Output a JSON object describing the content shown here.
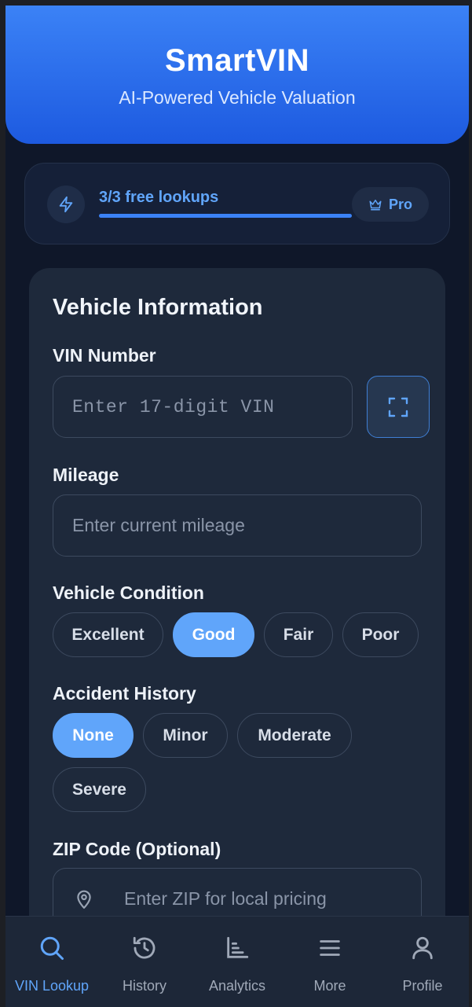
{
  "app": {
    "title": "SmartVIN",
    "subtitle": "AI-Powered Vehicle Valuation"
  },
  "quota": {
    "text": "3/3 free lookups",
    "used_fraction": 1.0,
    "pro_label": "Pro"
  },
  "form": {
    "title": "Vehicle Information",
    "vin": {
      "label": "VIN Number",
      "placeholder": "Enter 17-digit VIN",
      "value": ""
    },
    "mileage": {
      "label": "Mileage",
      "placeholder": "Enter current mileage",
      "value": ""
    },
    "condition": {
      "label": "Vehicle Condition",
      "options": [
        "Excellent",
        "Good",
        "Fair",
        "Poor"
      ],
      "selected": "Good"
    },
    "accident": {
      "label": "Accident History",
      "options": [
        "None",
        "Minor",
        "Moderate",
        "Severe"
      ],
      "selected": "None"
    },
    "zip": {
      "label": "ZIP Code (Optional)",
      "placeholder": "Enter ZIP for local pricing",
      "value": ""
    }
  },
  "tabs": [
    {
      "label": "VIN Lookup",
      "icon": "search-icon",
      "active": true
    },
    {
      "label": "History",
      "icon": "history-icon",
      "active": false
    },
    {
      "label": "Analytics",
      "icon": "analytics-icon",
      "active": false
    },
    {
      "label": "More",
      "icon": "menu-icon",
      "active": false
    },
    {
      "label": "Profile",
      "icon": "user-icon",
      "active": false
    }
  ],
  "colors": {
    "accent": "#60a5fa",
    "header_gradient_top": "#3b82f6",
    "header_gradient_bottom": "#1d5ae0",
    "background": "#0f1729",
    "card": "#1e293b"
  }
}
